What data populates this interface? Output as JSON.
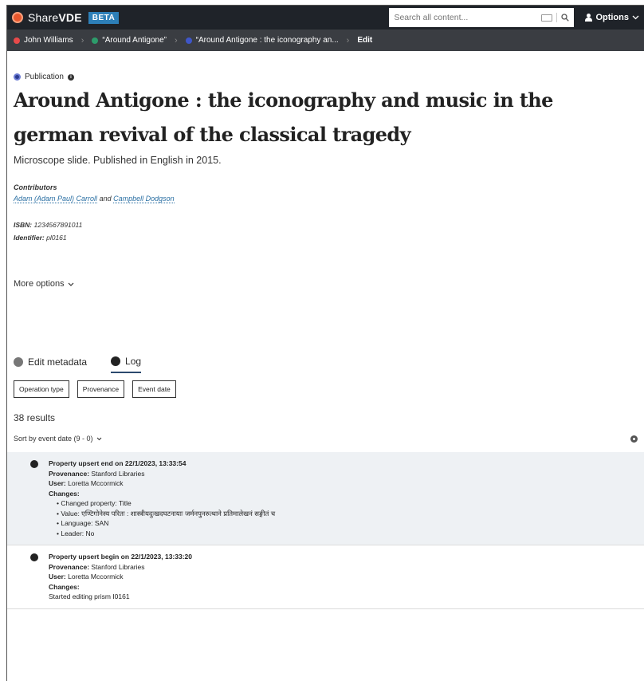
{
  "header": {
    "brand_share": "Share",
    "brand_vde": "VDE",
    "beta": "BETA",
    "search_placeholder": "Search all content...",
    "options_label": "Options"
  },
  "breadcrumb": [
    {
      "label": "John Williams",
      "dot_color": "#e84a4a"
    },
    {
      "label": "“Around Antigone”",
      "dot_color": "#2d9c6b"
    },
    {
      "label": "“Around Antigone : the iconography an...",
      "dot_color": "#3f56c8"
    },
    {
      "label": "Edit"
    }
  ],
  "publication": {
    "type_label": "Publication",
    "title": "Around Antigone : the iconography and music in the german revival of the classical tragedy",
    "summary": "Microscope slide. Published in English in 2015.",
    "contributors_heading": "Contributors",
    "contributor_1": "Adam (Adam Paul) Carroll",
    "contributor_and": "and",
    "contributor_2": "Campbell Dodgson",
    "isbn_label": "ISBN:",
    "isbn_value": "1234567891011",
    "identifier_label": "Identifier:",
    "identifier_value": "pl0161",
    "more_options": "More options"
  },
  "tabs": [
    {
      "label": "Edit metadata",
      "dot_color": "#777777"
    },
    {
      "label": "Log",
      "dot_color": "#222222"
    }
  ],
  "filters": [
    "Operation type",
    "Provenance",
    "Event date"
  ],
  "results_count": "38 results",
  "sort_label": "Sort by event date (9 - 0)",
  "log": [
    {
      "title": "Property upsert end on 22/1/2023, 13:33:54",
      "provenance_label": "Provenance:",
      "provenance": "Stanford Libraries",
      "user_label": "User:",
      "user": "Loretta Mccormick",
      "changes_label": "Changes:",
      "changes": [
        "Changed property: Title",
        "Value: एण्टिगोनेस्य परितः : शास्त्रीयदुःखदघटनायाः जर्मनपुनरुत्थाने प्रतिमालेखनं सङ्गीतं च",
        "Language: SAN",
        "Leader: No"
      ]
    },
    {
      "title": "Property upsert begin on 22/1/2023, 13:33:20",
      "provenance_label": "Provenance:",
      "provenance": "Stanford Libraries",
      "user_label": "User:",
      "user": "Loretta Mccormick",
      "changes_label": "Changes:",
      "note": "Started editing prism I0161"
    }
  ]
}
